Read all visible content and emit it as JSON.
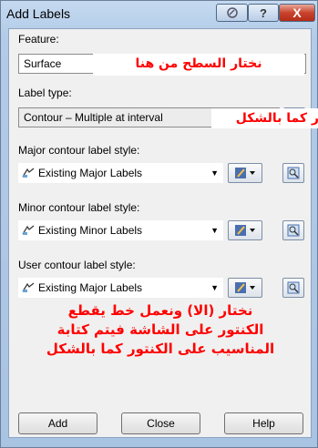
{
  "window": {
    "title": "Add Labels"
  },
  "titlebar": {
    "help_glyph": "?",
    "close_glyph": "X"
  },
  "feature": {
    "label": "Feature:",
    "value": "Surface"
  },
  "label_type": {
    "label": "Label type:",
    "value": "Contour – Multiple at interval"
  },
  "major": {
    "label": "Major contour label style:",
    "value": "Existing Major Labels"
  },
  "minor": {
    "label": "Minor contour label style:",
    "value": "Existing Minor Labels"
  },
  "user": {
    "label": "User contour label style:",
    "value": "Existing Major Labels"
  },
  "annotations": {
    "feature_note": "نختار السطح من هنا",
    "type_note": "ر كما بالشكل",
    "bottom_note_1": "نختار (الا) ونعمل خط يقطع",
    "bottom_note_2": "الكنتور على الشاشة فيتم كتابة",
    "bottom_note_3": "المناسيب على الكنتور كما بالشكل"
  },
  "buttons": {
    "add": "Add",
    "close": "Close",
    "help": "Help"
  }
}
